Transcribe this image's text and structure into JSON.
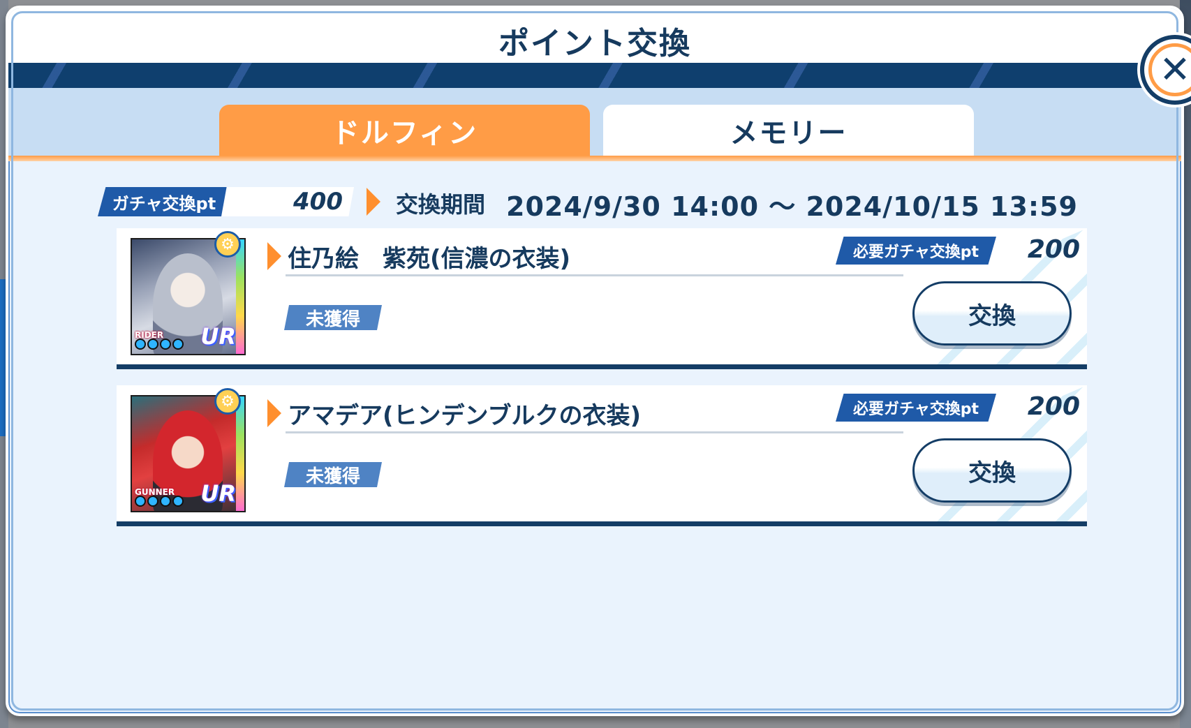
{
  "dialog": {
    "title": "ポイント交換"
  },
  "tabs": [
    {
      "label": "ドルフィン",
      "active": true
    },
    {
      "label": "メモリー",
      "active": false
    }
  ],
  "points": {
    "label": "ガチャ交換pt",
    "value": "400"
  },
  "period": {
    "label": "交換期間",
    "value": "2024/9/30 14:00 〜 2024/10/15 13:59"
  },
  "items": [
    {
      "name": "住乃絵　紫苑(信濃の衣装)",
      "status": "未獲得",
      "required_label": "必要ガチャ交換pt",
      "required_value": "200",
      "button_label": "交換",
      "class_label": "RIDER",
      "rarity": "UR"
    },
    {
      "name": "アマデア(ヒンデンブルクの衣装)",
      "status": "未獲得",
      "required_label": "必要ガチャ交換pt",
      "required_value": "200",
      "button_label": "交換",
      "class_label": "GUNNER",
      "rarity": "UR"
    }
  ],
  "icons": {
    "close": "close-icon",
    "gear": "gear-icon",
    "arrow": "orange-arrow-icon"
  },
  "colors": {
    "accent_orange": "#ff9c46",
    "navy": "#163a5e",
    "badge_blue": "#1f5aa8",
    "status_blue": "#4f83c4"
  }
}
